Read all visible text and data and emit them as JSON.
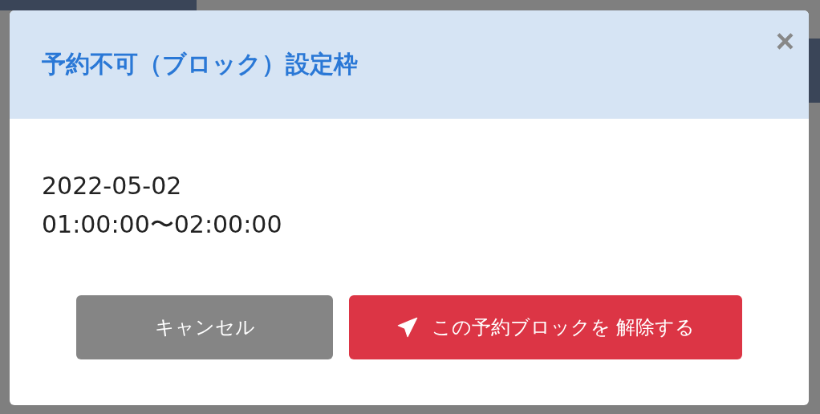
{
  "modal": {
    "title": "予約不可（ブロック）設定枠",
    "close": "×",
    "lines": [
      "2022-05-02",
      "01:00:00〜02:00:00"
    ],
    "buttons": [
      {
        "kind": "cancel",
        "label": "キャンセル"
      },
      {
        "kind": "danger",
        "label": "この予約ブロックを 解除する"
      }
    ]
  }
}
